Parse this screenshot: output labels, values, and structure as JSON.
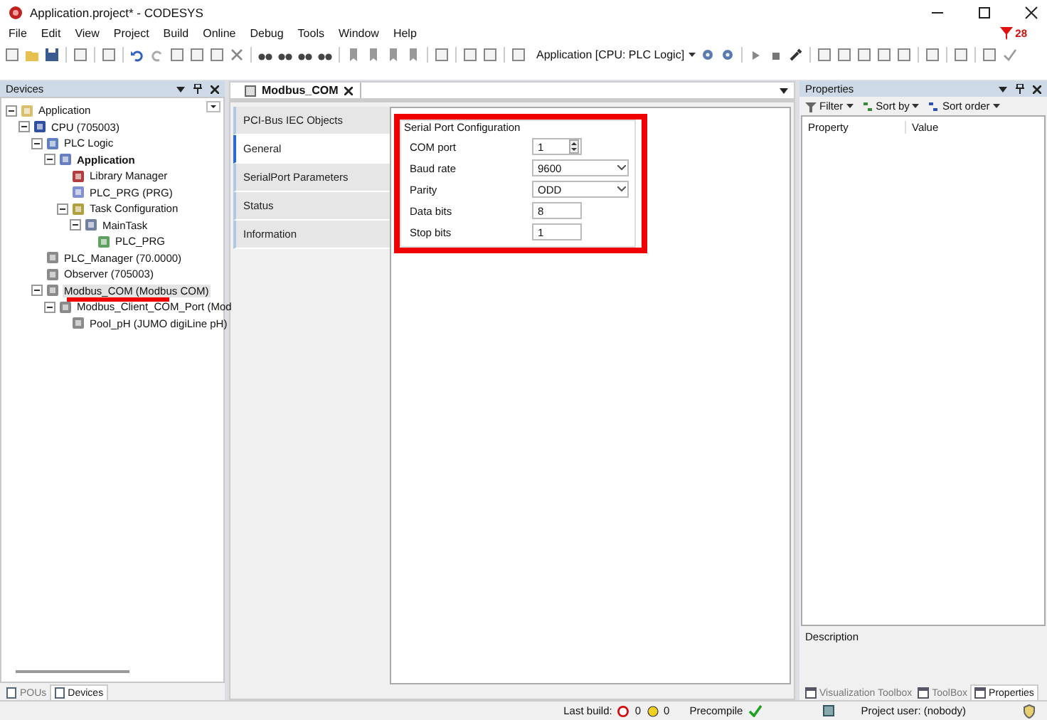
{
  "window": {
    "title": "Application.project* - CODESYS"
  },
  "menu": [
    "File",
    "Edit",
    "View",
    "Project",
    "Build",
    "Online",
    "Debug",
    "Tools",
    "Window",
    "Help"
  ],
  "notification_badge": "28",
  "toolbar": {
    "active_application": "Application [CPU: PLC Logic]"
  },
  "devices": {
    "title": "Devices",
    "tree": [
      {
        "label": "Application",
        "kind": "project",
        "active": false,
        "selected": false,
        "marked": false,
        "expanded": true,
        "children": [
          {
            "label": "CPU (705003)",
            "kind": "cpu",
            "active": false,
            "selected": false,
            "marked": false,
            "expanded": true,
            "children": [
              {
                "label": "PLC Logic",
                "kind": "logic",
                "active": false,
                "selected": false,
                "marked": false,
                "expanded": true,
                "children": [
                  {
                    "label": "Application",
                    "kind": "app",
                    "active": true,
                    "selected": false,
                    "marked": false,
                    "expanded": true,
                    "children": [
                      {
                        "label": "Library Manager",
                        "kind": "library",
                        "active": false,
                        "selected": false,
                        "marked": false
                      },
                      {
                        "label": "PLC_PRG (PRG)",
                        "kind": "pou",
                        "active": false,
                        "selected": false,
                        "marked": false
                      },
                      {
                        "label": "Task Configuration",
                        "kind": "taskconfig",
                        "active": false,
                        "selected": false,
                        "marked": false,
                        "expanded": true,
                        "children": [
                          {
                            "label": "MainTask",
                            "kind": "task",
                            "active": false,
                            "selected": false,
                            "marked": false,
                            "expanded": true,
                            "children": [
                              {
                                "label": "PLC_PRG",
                                "kind": "call",
                                "active": false,
                                "selected": false,
                                "marked": false
                              }
                            ]
                          }
                        ]
                      }
                    ]
                  }
                ]
              },
              {
                "label": "PLC_Manager (70.0000)",
                "kind": "device",
                "active": false,
                "selected": false,
                "marked": false
              },
              {
                "label": "Observer (705003)",
                "kind": "device",
                "active": false,
                "selected": false,
                "marked": false
              },
              {
                "label": "Modbus_COM (Modbus COM)",
                "kind": "device",
                "active": false,
                "selected": true,
                "marked": true,
                "expanded": true,
                "children": [
                  {
                    "label": "Modbus_Client_COM_Port (Mod",
                    "kind": "device",
                    "active": false,
                    "selected": false,
                    "marked": false,
                    "expanded": true,
                    "children": [
                      {
                        "label": "Pool_pH (JUMO digiLine pH)",
                        "kind": "device",
                        "active": false,
                        "selected": false,
                        "marked": false
                      }
                    ]
                  }
                ]
              }
            ]
          }
        ]
      }
    ]
  },
  "left_tabs": [
    {
      "label": "POUs",
      "selected": false
    },
    {
      "label": "Devices",
      "selected": true
    }
  ],
  "editor": {
    "tab": "Modbus_COM",
    "side_tabs": [
      {
        "label": "PCI-Bus IEC Objects",
        "selected": false
      },
      {
        "label": "General",
        "selected": true
      },
      {
        "label": "SerialPort Parameters",
        "selected": false
      },
      {
        "label": "Status",
        "selected": false
      },
      {
        "label": "Information",
        "selected": false
      }
    ],
    "group": {
      "title": "Serial Port Configuration",
      "highlighted": true,
      "fields": [
        {
          "label": "COM port",
          "kind": "spin",
          "value": "1"
        },
        {
          "label": "Baud rate",
          "kind": "dropdown",
          "value": "9600"
        },
        {
          "label": "Parity",
          "kind": "dropdown",
          "value": "ODD"
        },
        {
          "label": "Data bits",
          "kind": "text",
          "value": "8"
        },
        {
          "label": "Stop bits",
          "kind": "text",
          "value": "1"
        }
      ]
    }
  },
  "properties": {
    "title": "Properties",
    "tools": [
      "Filter",
      "Sort by",
      "Sort order"
    ],
    "columns": [
      "Property",
      "Value"
    ],
    "description": "Description",
    "tabs": [
      {
        "label": "Visualization Toolbox",
        "selected": false
      },
      {
        "label": "ToolBox",
        "selected": false
      },
      {
        "label": "Properties",
        "selected": true
      }
    ]
  },
  "status_bar": {
    "last_build": "Last build:",
    "errors": "0",
    "warnings": "0",
    "precompile": "Precompile",
    "user": "Project user: (nobody)"
  }
}
